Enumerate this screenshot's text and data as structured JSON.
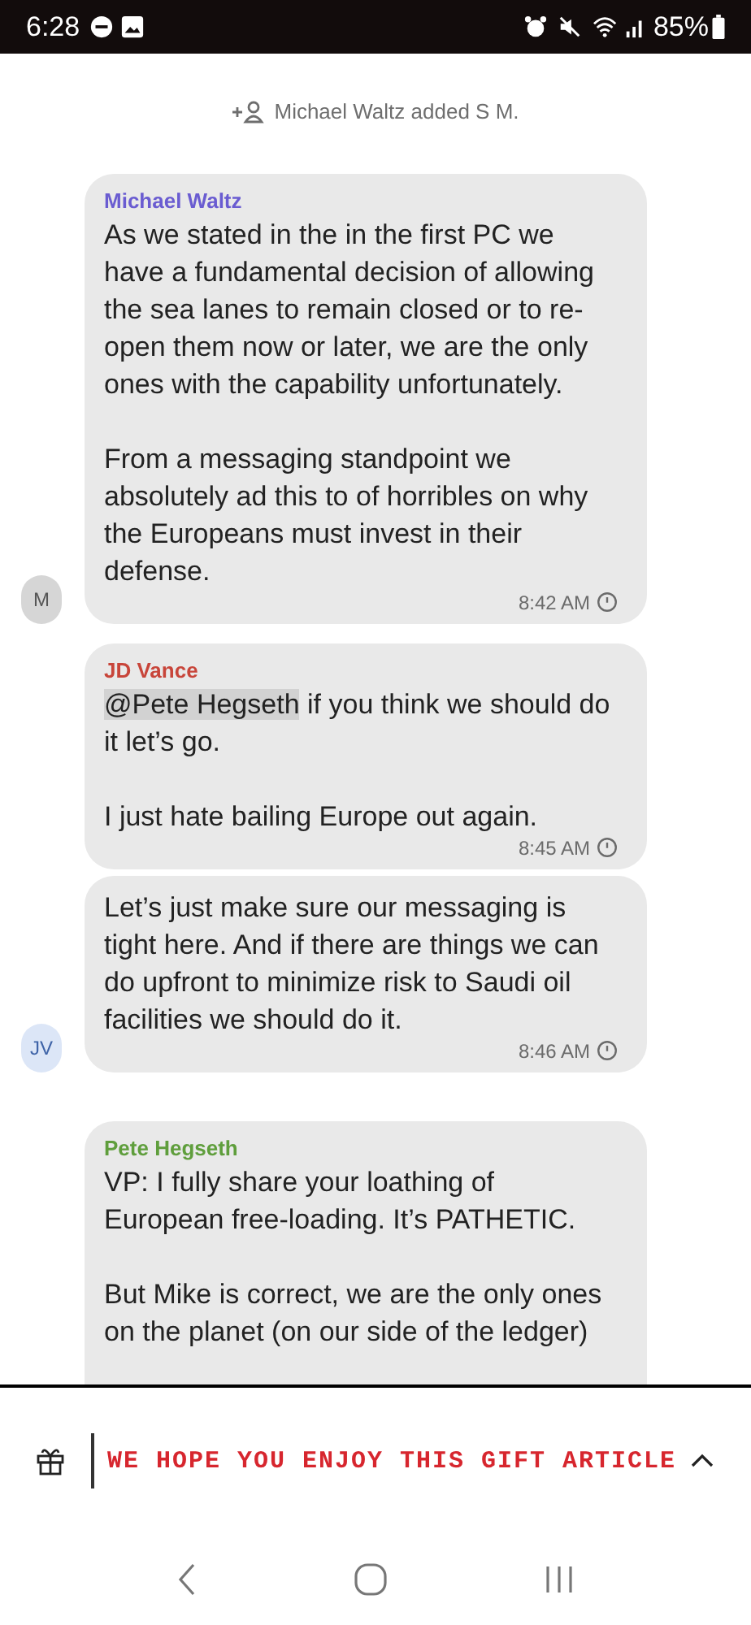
{
  "status_bar": {
    "time": "6:28",
    "battery": "85%"
  },
  "system_message": "Michael Waltz added S M.",
  "messages": [
    {
      "sender": "Michael Waltz",
      "color": "#6a5cd1",
      "paragraphs": [
        "As we stated in the in the first PC we have a fundamental decision of allowing the sea lanes to remain closed or to re-open them now or later, we are the only ones with the capability unfortunately.",
        "From a messaging standpoint we absolutely ad this to of horribles on why the Europeans must invest in their defense."
      ],
      "time": "8:42 AM",
      "avatar": "M"
    },
    {
      "sender": "JD Vance",
      "color": "#c8453a",
      "mention": "@Pete Hegseth",
      "paragraphs": [
        "if you think we should do it let’s go.",
        "I just hate bailing Europe out again."
      ],
      "time": "8:45 AM"
    },
    {
      "paragraphs": [
        "Let’s just make sure our messaging is tight here. And if there are things we can do upfront to minimize risk to Saudi oil facilities we should do it."
      ],
      "time": "8:46 AM",
      "avatar": "JV"
    },
    {
      "sender": "Pete Hegseth",
      "color": "#5f9e3c",
      "paragraphs": [
        "VP: I fully share your loathing of European free-loading. It’s PATHETIC.",
        "But Mike is correct, we are the only ones on the planet (on our side of the ledger)"
      ]
    }
  ],
  "banner": {
    "text": "WE HOPE YOU ENJOY THIS GIFT ARTICLE"
  }
}
